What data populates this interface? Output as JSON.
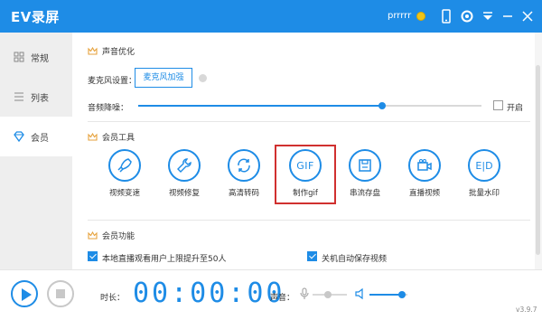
{
  "titlebar": {
    "app_title": "EV录屏",
    "username": "prrrrr",
    "icons": [
      "coin-icon",
      "phone-icon",
      "settings-icon",
      "dropdown-icon",
      "minimize-icon",
      "close-icon"
    ]
  },
  "sidebar": {
    "items": [
      {
        "label": "常规",
        "icon": "grid-icon",
        "active": false
      },
      {
        "label": "列表",
        "icon": "list-icon",
        "active": false
      },
      {
        "label": "会员",
        "icon": "diamond-icon",
        "active": true
      }
    ]
  },
  "sound_opt": {
    "title": "声音优化",
    "mic_label": "麦克风设置：",
    "mic_button": "麦克风加强",
    "denoise_label": "音频降噪：",
    "denoise_level": 0.71,
    "open_label": "开启",
    "open_checked": false
  },
  "member_tools": {
    "title": "会员工具",
    "tools": [
      {
        "label": "视频变速",
        "icon": "rocket-icon"
      },
      {
        "label": "视频修复",
        "icon": "wrench-icon"
      },
      {
        "label": "高清转码",
        "icon": "convert-icon"
      },
      {
        "label": "制作gif",
        "icon": "gif-icon",
        "icon_text": "GIF",
        "highlighted": true
      },
      {
        "label": "串流存盘",
        "icon": "save-icon"
      },
      {
        "label": "直播视频",
        "icon": "camera-icon"
      },
      {
        "label": "批量水印",
        "icon": "watermark-icon",
        "icon_text": "E|D"
      }
    ]
  },
  "member_features": {
    "title": "会员功能",
    "options": [
      {
        "label": "本地直播观看用户上限提升至50人",
        "checked": true
      },
      {
        "label": "关机自动保存视频",
        "checked": true
      }
    ]
  },
  "bottombar": {
    "time_label": "时长：",
    "timer": "00:00:00",
    "sound_label": "声音：",
    "mic_volume": 0.45,
    "speaker_volume": 0.85,
    "version": "v3.9.7"
  },
  "colors": {
    "accent": "#1e8ce6",
    "highlight": "#d0302f"
  }
}
